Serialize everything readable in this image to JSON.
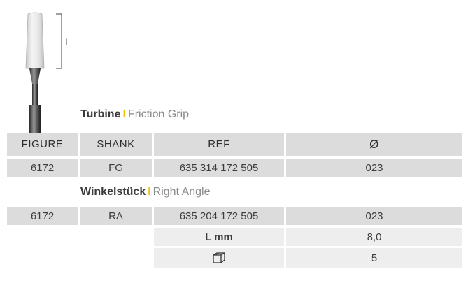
{
  "drawing": {
    "length_label": "L"
  },
  "turbine": {
    "title": "Turbine",
    "separator": "I",
    "subtitle": "Friction Grip"
  },
  "table_header": {
    "figure": "FIGURE",
    "shank": "SHANK",
    "ref": "REF",
    "diameter": "Ø"
  },
  "turbine_row": {
    "figure": "6172",
    "shank": "FG",
    "ref": "635 314 172 505",
    "diameter": "023"
  },
  "winkel": {
    "title": "Winkelstück",
    "separator": "I",
    "subtitle": "Right Angle"
  },
  "winkel_row": {
    "figure": "6172",
    "shank": "RA",
    "ref": "635 204 172 505",
    "diameter": "023"
  },
  "specs": [
    {
      "label": "L mm",
      "value": "8,0"
    },
    {
      "icon": "package-icon",
      "value": "5"
    }
  ],
  "colors": {
    "accent": "#f2c200",
    "cell_dark": "#dcdcdc",
    "cell_light": "#eeeeee"
  }
}
